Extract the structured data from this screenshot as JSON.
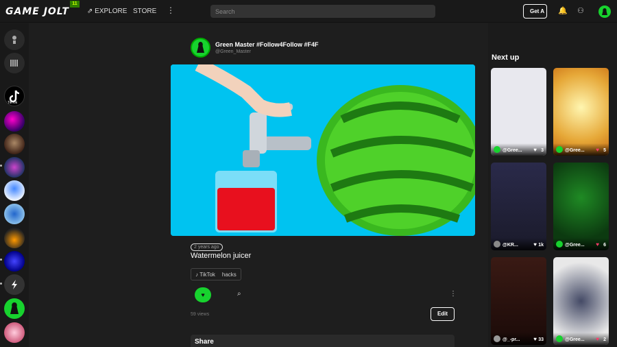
{
  "header": {
    "logo": "GAME JOLT",
    "logo_badge": "11",
    "explore_label": "EXPLORE",
    "store_label": "STORE",
    "search_placeholder": "Search",
    "get_app_label": "Get A"
  },
  "sidebar": {
    "items": [
      {
        "name": "TikTok"
      }
    ]
  },
  "post": {
    "author_name": "Green Master #Follow4Follow #F4F",
    "author_handle": "@Green_Master",
    "timestamp": "2 years ago",
    "caption": "Watermelon juicer",
    "tags": [
      "TikTok",
      "hacks"
    ],
    "views": "59 views",
    "edit_label": "Edit",
    "share_title": "Share"
  },
  "next_up": {
    "title": "Next up",
    "cards": [
      {
        "user": "@Gree...",
        "likes": "3",
        "heart": "white",
        "bg": "#e8e8ee"
      },
      {
        "user": "@Gree...",
        "likes": "5",
        "heart": "pink",
        "bg": "#e6a838"
      },
      {
        "user": "@KR...",
        "likes": "1k",
        "heart": "white",
        "bg": "#2a2a4a"
      },
      {
        "user": "@Gree...",
        "likes": "6",
        "heart": "pink",
        "bg": "#0c3a10"
      },
      {
        "user": "@_-pr...",
        "likes": "33",
        "heart": "white",
        "bg": "#3a1a14"
      },
      {
        "user": "@Gree...",
        "likes": "2",
        "heart": "pink",
        "bg": "#e8e8e8"
      }
    ]
  },
  "colors": {
    "accent": "#17d22e",
    "pink_heart": "#ff3b6b",
    "media_bg": "#00c3f0"
  }
}
